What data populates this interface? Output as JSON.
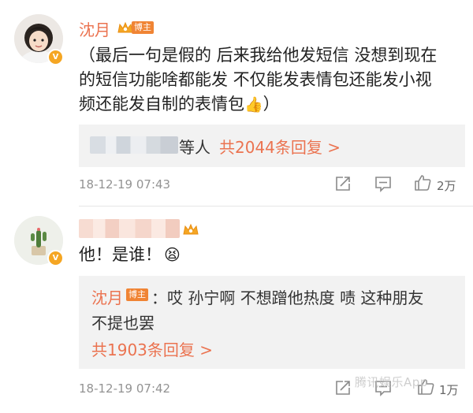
{
  "comments": [
    {
      "author": "沈月",
      "author_badge": "博主",
      "vip_badge": "V",
      "text_line1": "（最后一句是假的 后来我给他发短信 没想到现在",
      "text_line2": "的短信功能啥都能发 不仅能发表情包还能发小视",
      "text_line3": "频还能发自制的表情包",
      "text_end": "）",
      "emoji": "👍",
      "replies_summary_suffix": "等人",
      "replies_link": "共2044条回复 >",
      "timestamp": "18-12-19 07:43",
      "like_count": "2万"
    },
    {
      "author_hidden": true,
      "vip_badge": "V",
      "text": "他！是谁！",
      "emoji": "😫",
      "nested_reply_author": "沈月",
      "nested_reply_badge": "博主",
      "nested_reply_text_line1": "：哎 孙宁啊 不想蹭他热度 啧 这种朋友",
      "nested_reply_text_line2": "不提也罢",
      "replies_link": "共1903条回复 >",
      "timestamp": "18-12-19 07:42",
      "like_count": "1万"
    }
  ],
  "watermark": "腾讯娱乐App",
  "icons": {
    "share": "share-icon",
    "comment": "comment-icon",
    "like": "like-icon"
  },
  "colors": {
    "accent": "#eb7350",
    "badge": "#f08434",
    "meta": "#939393",
    "reply_bg": "#f2f2f2"
  }
}
